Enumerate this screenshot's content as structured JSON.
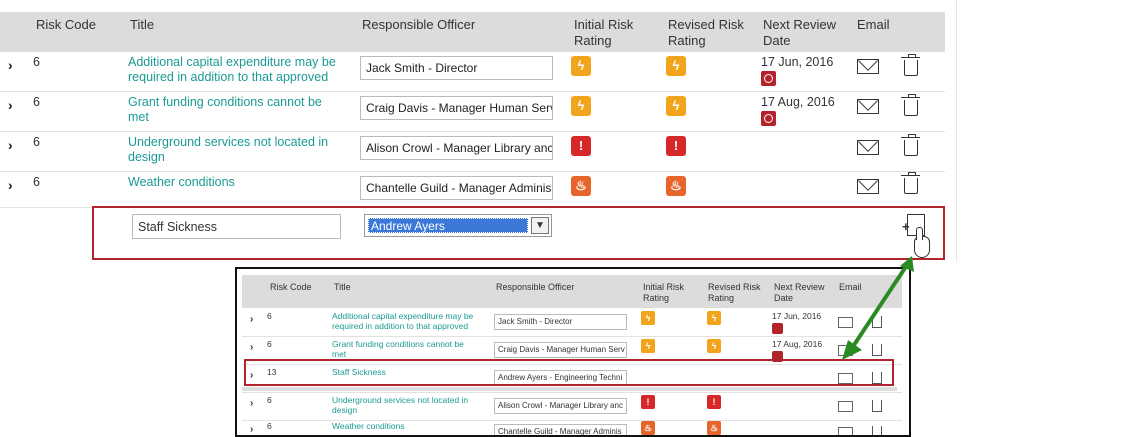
{
  "header": {
    "risk_code": "Risk Code",
    "title": "Title",
    "responsible_officer": "Responsible Officer",
    "initial_risk_rating": "Initial Risk Rating",
    "revised_risk_rating": "Revised Risk Rating",
    "next_review_date": "Next Review Date",
    "email": "Email"
  },
  "rows": [
    {
      "code": "6",
      "title": "Additional capital expenditure may be required in addition to that approved",
      "officer": "Jack Smith - Director",
      "initial_icon": "lightning-icon",
      "revised_icon": "lightning-icon",
      "date": "17 Jun, 2016"
    },
    {
      "code": "6",
      "title": "Grant funding conditions cannot be met",
      "officer": "Craig Davis - Manager Human Serv",
      "initial_icon": "lightning-icon",
      "revised_icon": "lightning-icon",
      "date": "17 Aug, 2016"
    },
    {
      "code": "6",
      "title": "Underground services not located in design",
      "officer": "Alison Crowl - Manager Library anc",
      "initial_icon": "exclamation-icon",
      "revised_icon": "exclamation-icon",
      "date": ""
    },
    {
      "code": "6",
      "title": "Weather conditions",
      "officer": "Chantelle Guild - Manager Adminis",
      "initial_icon": "fire-icon",
      "revised_icon": "fire-icon",
      "date": ""
    }
  ],
  "new_row": {
    "title_value": "Staff Sickness",
    "officer_selected": "Andrew Ayers"
  },
  "inset": {
    "header": {
      "risk_code": "Risk Code",
      "title": "Title",
      "responsible_officer": "Responsible Officer",
      "initial_risk_rating": "Initial Risk Rating",
      "revised_risk_rating": "Revised Risk Rating",
      "next_review_date": "Next Review Date",
      "email": "Email"
    },
    "rows": [
      {
        "code": "6",
        "title": "Additional capital expenditure may be required in addition to that approved",
        "officer": "Jack Smith - Director",
        "date": "17 Jun, 2016"
      },
      {
        "code": "6",
        "title": "Grant funding conditions cannot be met",
        "officer": "Craig Davis - Manager Human Serv",
        "date": "17 Aug, 2016"
      },
      {
        "code": "13",
        "title": "Staff Sickness",
        "officer": "Andrew Ayers - Engineering Techni",
        "date": ""
      },
      {
        "code": "6",
        "title": "Underground services not located in design",
        "officer": "Alison Crowl - Manager Library anc",
        "date": ""
      },
      {
        "code": "6",
        "title": "Weather conditions",
        "officer": "Chantelle Guild - Manager Adminis",
        "date": ""
      }
    ]
  },
  "colors": {
    "link": "#1a9a93",
    "rating_orange": "#f2a41d",
    "rating_red": "#d62828",
    "rating_fire": "#e7652a",
    "highlight": "#b3232b",
    "arrow": "#2a8a22"
  }
}
